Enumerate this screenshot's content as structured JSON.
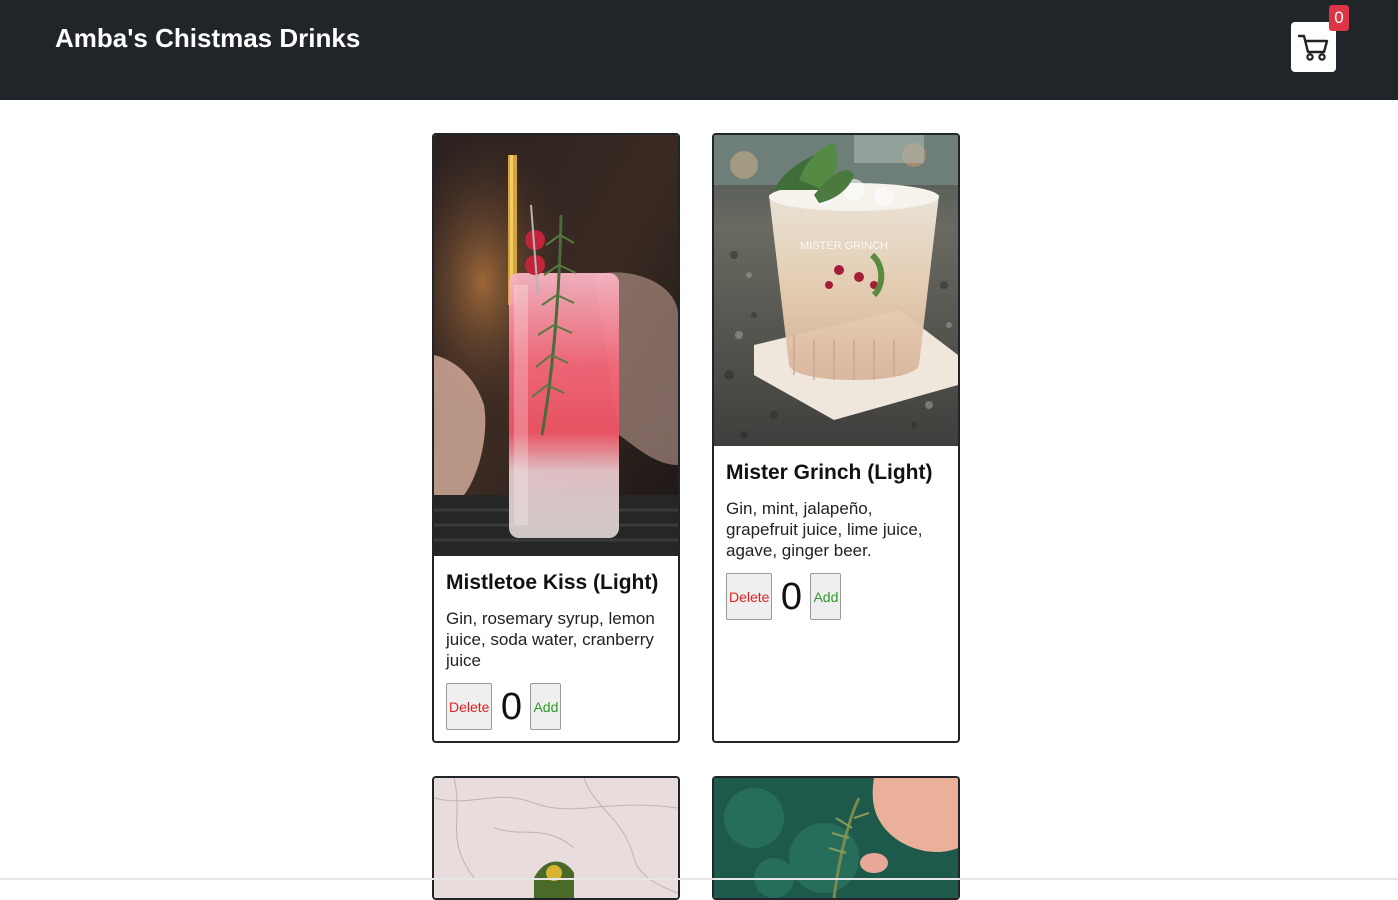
{
  "header": {
    "title": "Amba's Chistmas Drinks",
    "cart_count": "0"
  },
  "drinks": [
    {
      "name": "Mistletoe Kiss (Light)",
      "description": "Gin, rosemary syrup, lemon juice, soda water, cranberry juice",
      "quantity": "0",
      "delete_label": "Delete",
      "add_label": "Add"
    },
    {
      "name": "Mister Grinch (Light)",
      "description": "Gin, mint, jalapeño, grapefruit juice, lime juice, agave, ginger beer.",
      "quantity": "0",
      "delete_label": "Delete",
      "add_label": "Add",
      "image_caption": "MISTER GRINCH"
    }
  ],
  "colors": {
    "navbar": "#212529",
    "badge": "#dc3545",
    "delete": "#e02020",
    "add": "#2e9a2e"
  }
}
